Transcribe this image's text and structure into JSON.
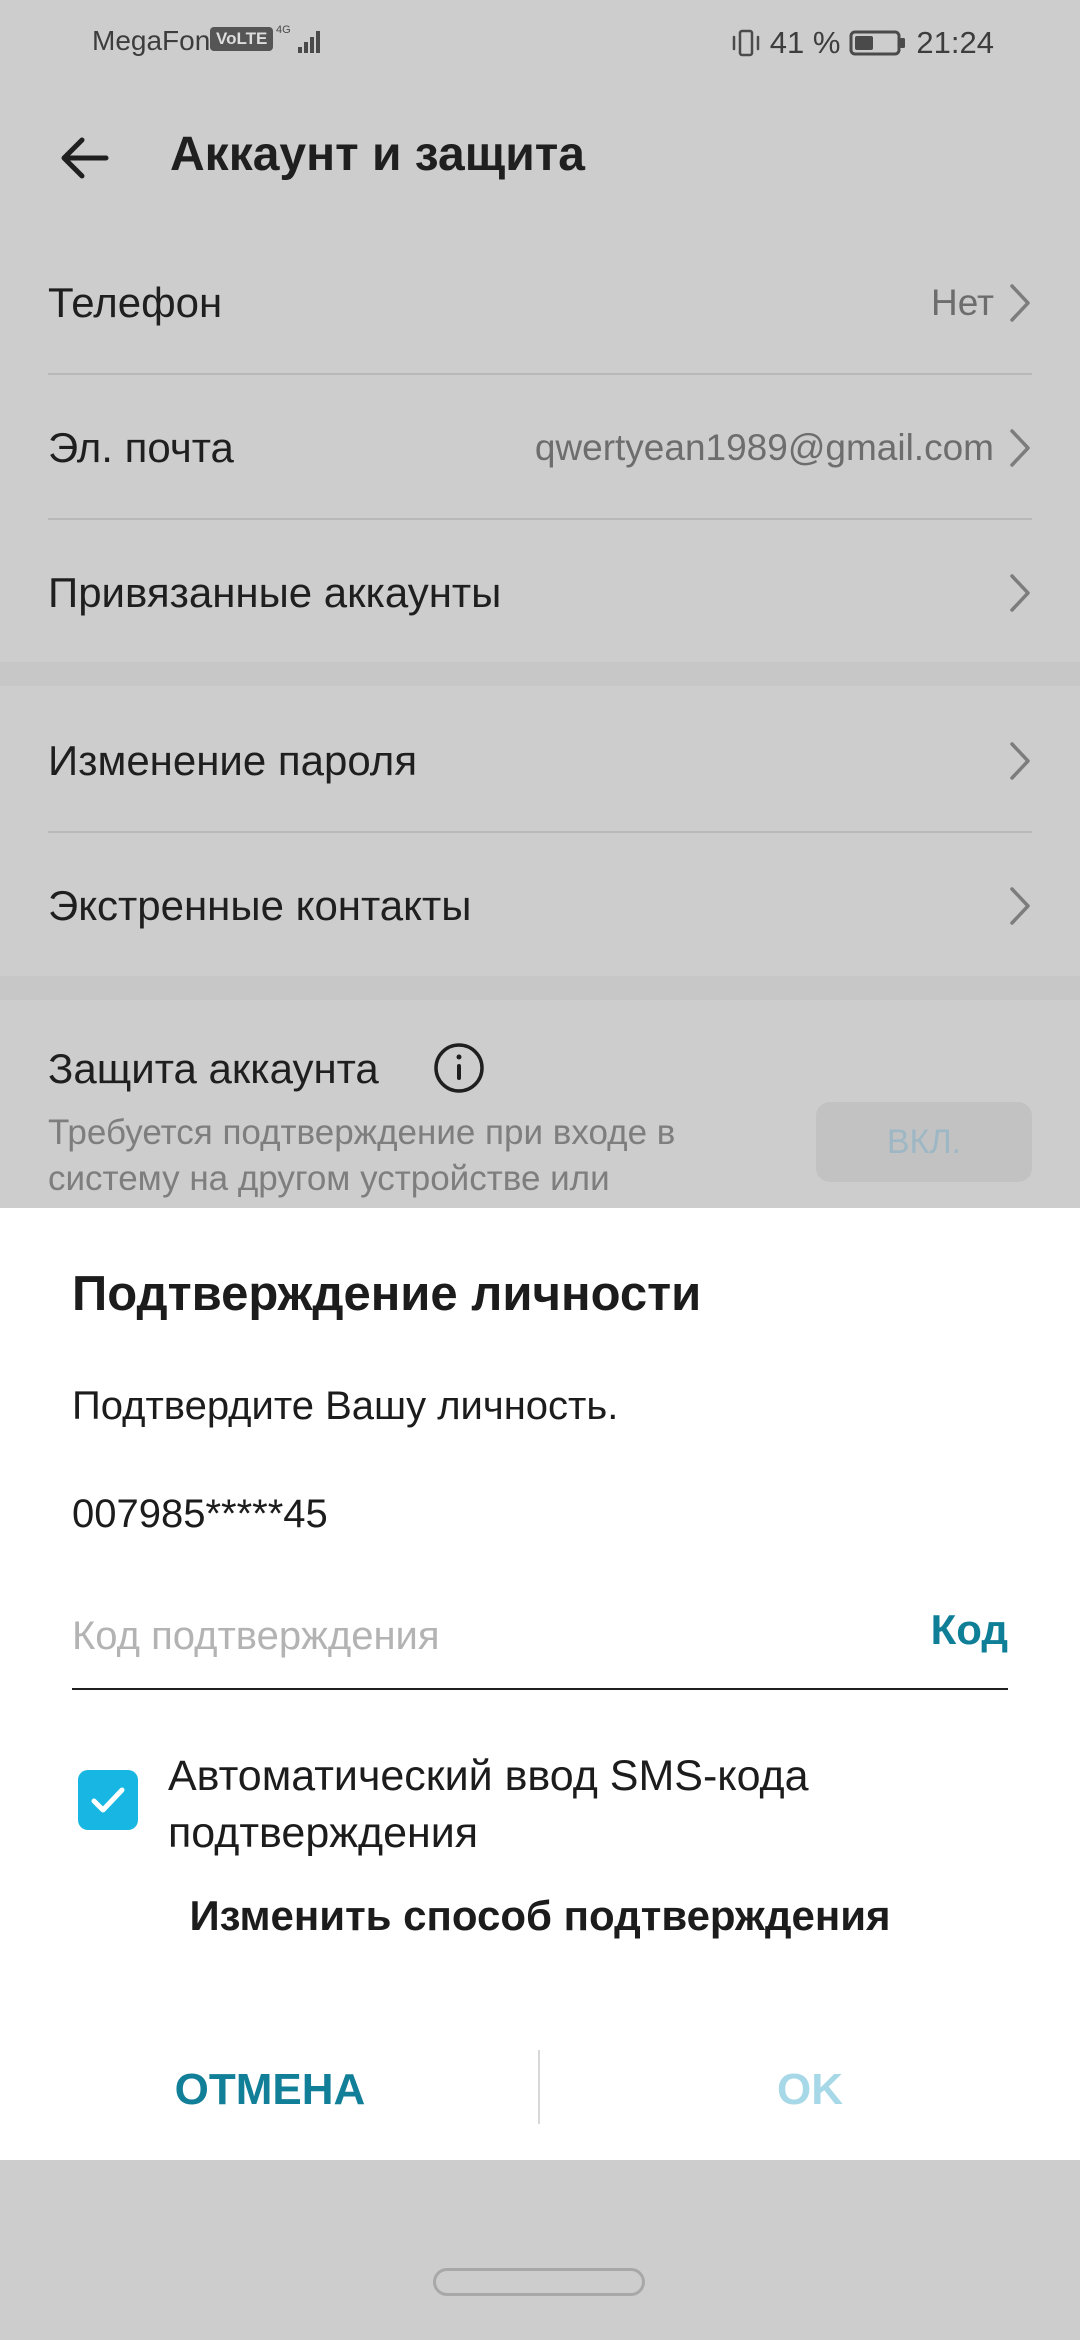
{
  "status_bar": {
    "carrier": "MegaFon",
    "volte": "VoLTE",
    "network": "4G",
    "battery": "41 %",
    "time": "21:24",
    "icons": [
      "signal-icon",
      "vibrate-icon",
      "battery-icon"
    ]
  },
  "header": {
    "title": "Аккаунт и защита",
    "back_icon": "back-arrow-icon"
  },
  "settings": {
    "items": [
      {
        "label": "Телефон",
        "value": "Нет"
      },
      {
        "label": "Эл. почта",
        "value": "qwertyean1989@gmail.com"
      },
      {
        "label": "Привязанные аккаунты",
        "value": ""
      },
      {
        "label": "Изменение пароля",
        "value": ""
      },
      {
        "label": "Экстренные контакты",
        "value": ""
      }
    ],
    "security": {
      "title": "Защита аккаунта",
      "description": "Требуется подтверждение при входе в систему на другом устройстве или",
      "button": "ВКЛ."
    }
  },
  "dialog": {
    "title": "Подтверждение личности",
    "message": "Подтвердите Вашу личность.",
    "masked_phone": "007985*****45",
    "code_input": {
      "placeholder": "Код подтверждения",
      "value": "",
      "button": "Код"
    },
    "auto_sms": {
      "checked": true,
      "label": "Автоматический ввод SMS-кода подтверждения"
    },
    "change_method": "Изменить способ подтверждения",
    "cancel": "ОТМЕНА",
    "ok": "OK"
  },
  "colors": {
    "accent": "#127F98",
    "checkbox": "#18B7E3",
    "disabled_accent": "#A6D8E7"
  }
}
